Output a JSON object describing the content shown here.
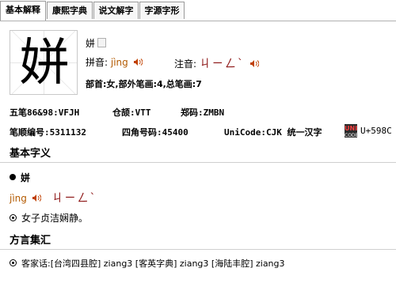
{
  "tabs": [
    {
      "label": "基本解释"
    },
    {
      "label": "康熙字典"
    },
    {
      "label": "说文解字"
    },
    {
      "label": "字源字形"
    }
  ],
  "entry": {
    "character": "姘",
    "small_char": "姘",
    "pinyin_label": "拼音:",
    "pinyin": "jìng",
    "zhuyin_label": "注音:",
    "zhuyin": "ㄐㄧㄥˋ",
    "radical_line": "部首:女,部外笔画:4,总笔画:7"
  },
  "codes": {
    "wubi": "五笔86&98:VFJH",
    "cangjie": "仓颉:VTT",
    "zhengma": "郑码:ZMBN",
    "stroke_no": "笔顺编号:5311132",
    "four_corner": "四角号码:45400",
    "unicode": "UniCode:CJK 统一汉字",
    "unicode_point": "U+598C",
    "badge_top": "UNI",
    "badge_bottom": "CODE"
  },
  "basic": {
    "title": "基本字义",
    "char": "姘",
    "pinyin": "jìng",
    "zhuyin": "ㄐㄧㄥˋ",
    "definition": "女子贞洁娴静。"
  },
  "dialect": {
    "title": "方言集汇",
    "line": "客家话:[台湾四县腔] ziang3 [客英字典] ziang3 [海陆丰腔] ziang3"
  },
  "colors": {
    "zhuyin": "#8a1010",
    "pinyin": "#b35a00",
    "rule": "#cfcfcf"
  }
}
